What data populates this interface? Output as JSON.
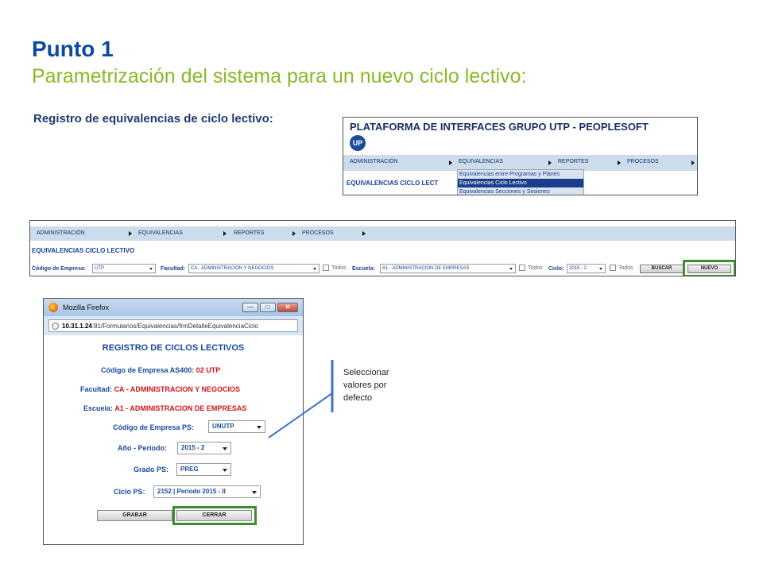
{
  "slide": {
    "title": "Punto 1",
    "subtitle": "Parametrización del sistema para un nuevo ciclo lectivo:",
    "section_label": "Registro de equivalencias de ciclo lectivo:"
  },
  "panel1": {
    "header": "PLATAFORMA DE INTERFACES GRUPO UTP - PEOPLESOFT",
    "logo_text": "UP",
    "nav": [
      "ADMINISTRACIÓN",
      "EQUIVALENCIAS",
      "REPORTES",
      "PROCESOS"
    ],
    "page_heading": "EQUIVALENCIAS CICLO LECT",
    "dropdown_items": [
      "Equivalencias entre Programas y Planes",
      "Equivalencias Ciclo Lectivo",
      "Equivalencias Secciones y Sesiones"
    ]
  },
  "panel2": {
    "nav": [
      "ADMINISTRACIÓN",
      "EQUIVALENCIAS",
      "REPORTES",
      "PROCESOS"
    ],
    "page_heading": "EQUIVALENCIAS CICLO LECTIVO",
    "codigo_empresa_label": "Código de Empresa:",
    "codigo_empresa_value": "UTP",
    "facultad_label": "Facultad:",
    "facultad_value": "CA - ADMINISTRACION Y NEGOCIOS",
    "todos_label": "Todos",
    "escuela_label": "Escuela:",
    "escuela_value": "A1 - ADMINISTRACION DE EMPRESAS",
    "ciclo_label": "Ciclo:",
    "ciclo_value": "2015 - 2",
    "buscar_label": "BUSCAR",
    "nuevo_label": "NUEVO"
  },
  "dialog": {
    "window_title": "Mozilla Firefox",
    "minimize": "—",
    "maximize": "□",
    "close": "✕",
    "url_host": "10.31.1.24",
    "url_path": ":81/Formularios/Equivalencias/frmDetalleEquivalenciaCiclo",
    "heading": "REGISTRO DE CICLOS LECTIVOS",
    "cod_empresa_as400_label": "Código de Empresa AS400:",
    "cod_empresa_as400_value": "02  UTP",
    "facultad_label": "Facultad:",
    "facultad_value": "CA - ADMINISTRACION Y NEGOCIOS",
    "escuela_label": "Escuela:",
    "escuela_value": "A1 - ADMINISTRACION DE EMPRESAS",
    "cod_empresa_ps_label": "Código de Empresa PS:",
    "cod_empresa_ps_value": "UNUTP",
    "anio_periodo_label": "Año - Periodo:",
    "anio_periodo_value": "2015 - 2",
    "grado_ps_label": "Grado PS:",
    "grado_ps_value": "PREG",
    "ciclo_ps_label": "Ciclo PS:",
    "ciclo_ps_value": "2152 | Periodo 2015 - II",
    "grabar_label": "GRABAR",
    "cerrar_label": "CERRAR"
  },
  "callout": {
    "line1": "Seleccionar",
    "line2": "valores por",
    "line3": "defecto"
  },
  "colors": {
    "title_blue": "#0a4aa0",
    "subtitle_green": "#8ab928",
    "highlight_green": "#3e8e2e",
    "nav_bg": "#ccdcec",
    "value_red": "#d4151a"
  }
}
